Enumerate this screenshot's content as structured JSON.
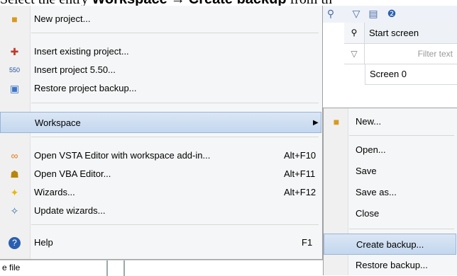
{
  "caption": {
    "prefix": "Select the entry ",
    "workspace": "Workspace",
    "arrow": " → ",
    "create_backup": "Create backup",
    "suffix": " from th"
  },
  "toolbar": {
    "icons": [
      "search-binoculars-icon",
      "filter-icon",
      "properties-icon",
      "help-icon"
    ]
  },
  "grid": {
    "header": "Start screen",
    "filter_placeholder": "Filter text",
    "cell": "Screen 0"
  },
  "main_menu": {
    "items": [
      {
        "label": "New project...",
        "icon": "new-project-icon",
        "shortcut": ""
      },
      {
        "label": "Insert existing project...",
        "icon": "insert-project-icon",
        "shortcut": ""
      },
      {
        "label": "Insert project 5.50...",
        "icon": "project-550-icon",
        "shortcut": ""
      },
      {
        "label": "Restore project backup...",
        "icon": "restore-backup-icon",
        "shortcut": ""
      },
      {
        "label": "Workspace",
        "icon": "",
        "shortcut": ""
      },
      {
        "label": "Open VSTA Editor with workspace add-in...",
        "icon": "vsta-icon",
        "shortcut": "Alt+F10"
      },
      {
        "label": "Open VBA Editor...",
        "icon": "vba-icon",
        "shortcut": "Alt+F11"
      },
      {
        "label": "Wizards...",
        "icon": "wizard-icon",
        "shortcut": "Alt+F12"
      },
      {
        "label": "Update wizards...",
        "icon": "update-wizards-icon",
        "shortcut": ""
      },
      {
        "label": "Help",
        "icon": "help-icon",
        "shortcut": "F1"
      }
    ]
  },
  "submenu": {
    "items": [
      {
        "label": "New...",
        "icon": "new-workspace-icon"
      },
      {
        "label": "Open..."
      },
      {
        "label": "Save"
      },
      {
        "label": "Save as..."
      },
      {
        "label": "Close"
      },
      {
        "label": "Create backup..."
      },
      {
        "label": "Restore backup..."
      }
    ]
  },
  "bottom": {
    "text": "e file"
  },
  "colors": {
    "highlight": "#c3d7ef",
    "highlight_border": "#99b4d8",
    "menu_bg": "#f5f6f7"
  }
}
